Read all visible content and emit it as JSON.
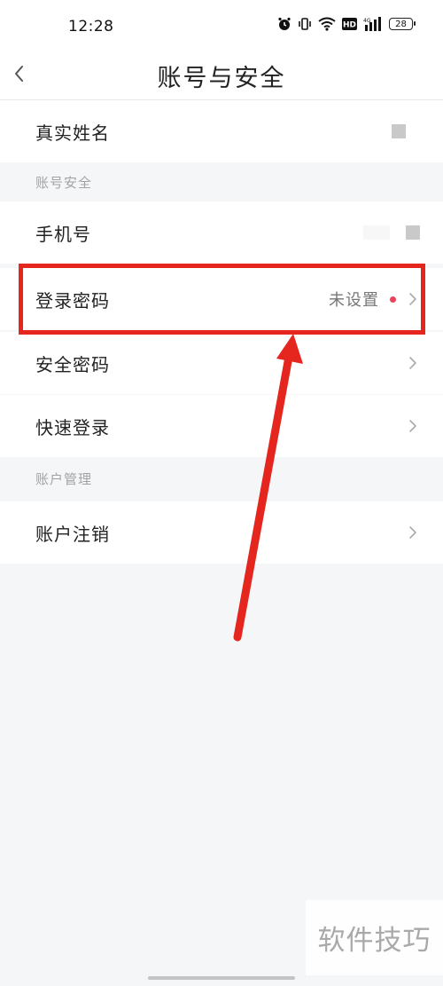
{
  "status_bar": {
    "time": "12:28",
    "battery": "28",
    "icons": [
      "alarm-icon",
      "vibrate-icon",
      "wifi-icon",
      "hd-icon",
      "signal-icon",
      "battery-icon"
    ]
  },
  "header": {
    "title": "账号与安全",
    "back_icon": "chevron-left-icon"
  },
  "rows": {
    "real_name": {
      "label": "真实姓名"
    },
    "phone": {
      "label": "手机号"
    },
    "login_password": {
      "label": "登录密码",
      "value": "未设置"
    },
    "security_password": {
      "label": "安全密码"
    },
    "quick_login": {
      "label": "快速登录"
    },
    "cancel_account": {
      "label": "账户注销"
    }
  },
  "sections": {
    "account_security": "账号安全",
    "account_management": "账户管理"
  },
  "annotation": {
    "highlight_color": "#e5261f"
  },
  "watermark": {
    "text": "软件技巧"
  },
  "colors": {
    "accent_dot": "#e9445a",
    "background": "#f5f6f8",
    "row_bg": "#ffffff"
  }
}
